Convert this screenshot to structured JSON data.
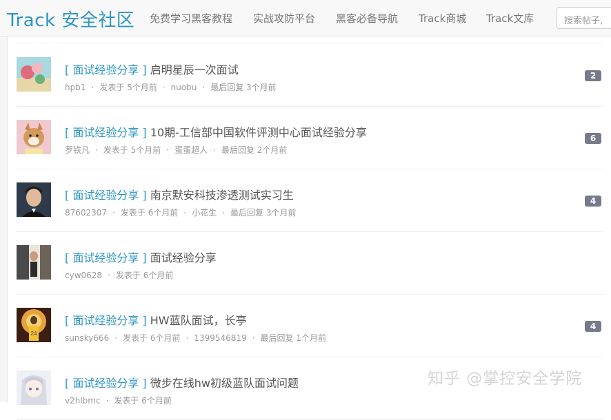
{
  "header": {
    "brand": "Track 安全社区",
    "nav": [
      "免费学习黑客教程",
      "实战攻防平台",
      "黑客必备导航",
      "Track商城",
      "Track文库"
    ],
    "search_placeholder": "搜索帖子,"
  },
  "topics": [
    {
      "category": "[ 面试经验分享 ]",
      "title": "启明星辰一次面试",
      "author": "hpb1",
      "posted": "发表于 5个月前",
      "last_replier": "nuobu",
      "last_reply": "最后回复 3个月前",
      "reply_count": "2"
    },
    {
      "category": "[ 面试经验分享 ]",
      "title": "10期-工信部中国软件评测中心面试经验分享",
      "author": "罗铁凡",
      "posted": "发表于 5个月前",
      "last_replier": "蛋蛋超人",
      "last_reply": "最后回复 2个月前",
      "reply_count": "6"
    },
    {
      "category": "[ 面试经验分享 ]",
      "title": "南京默安科技渗透测试实习生",
      "author": "87602307",
      "posted": "发表于 6个月前",
      "last_replier": "小花生",
      "last_reply": "最后回复 3个月前",
      "reply_count": "4"
    },
    {
      "category": "[ 面试经验分享 ]",
      "title": "面试经验分享",
      "author": "cyw0628",
      "posted": "发表于 6个月前"
    },
    {
      "category": "[ 面试经验分享 ]",
      "title": "HW蓝队面试，长亭",
      "author": "sunsky666",
      "posted": "发表于 6个月前",
      "last_replier": "1399546819",
      "last_reply": "最后回复 1个月前",
      "reply_count": "4"
    },
    {
      "category": "[ 面试经验分享 ]",
      "title": "微步在线hw初级蓝队面试问题",
      "author": "v2hlbmc",
      "posted": "发表于 6个月前"
    }
  ],
  "watermark": "知乎 @掌控安全学院",
  "colors": {
    "brand": "#2b95c6",
    "badge": "#777a8d",
    "meta": "#999999"
  }
}
